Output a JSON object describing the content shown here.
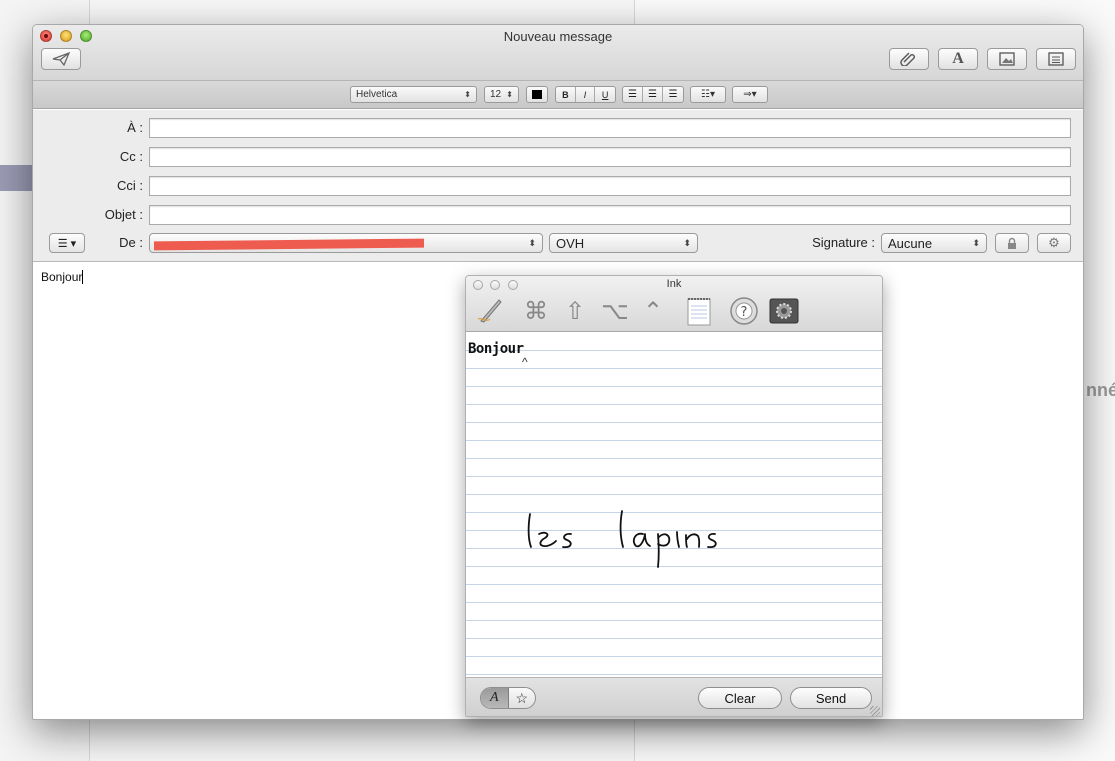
{
  "window": {
    "title": "Nouveau message"
  },
  "format": {
    "font": "Helvetica",
    "size": "12",
    "bold": "B",
    "italic": "I",
    "underline": "U"
  },
  "fields": {
    "to_label": "À :",
    "cc_label": "Cc :",
    "bcc_label": "Cci :",
    "subject_label": "Objet :",
    "from_label": "De :",
    "account": "OVH",
    "signature_label": "Signature :",
    "signature_value": "Aucune"
  },
  "message": {
    "body": "Bonjour"
  },
  "ink": {
    "title": "Ink",
    "recognized": "Bonjour",
    "clear_label": "Clear",
    "send_label": "Send"
  },
  "background": {
    "partial_text": "nné"
  },
  "colors": {
    "redaction": "#ee5c50",
    "ruling": "#c6d4e8"
  }
}
